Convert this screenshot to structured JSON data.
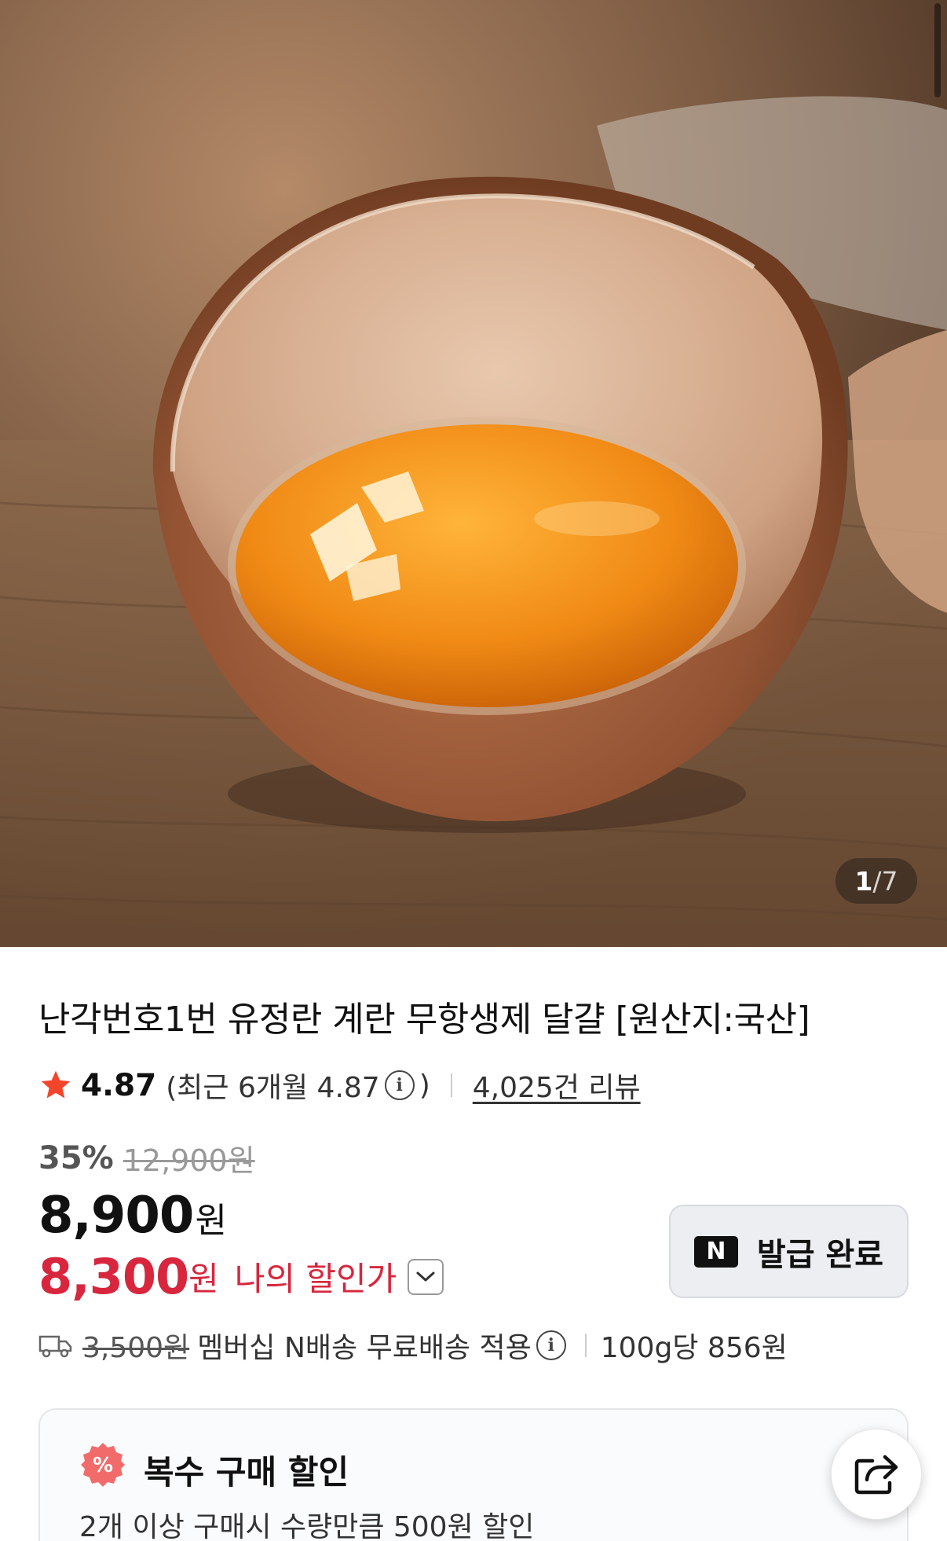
{
  "image": {
    "current": "1",
    "separator": "/",
    "total": "7"
  },
  "product": {
    "title": "난각번호1번 유정란 계란 무항생제 달걀 [원산지:국산]",
    "rating": "4.87",
    "recent_rating": "(최근 6개월 4.87",
    "recent_close": ")",
    "review_count": "4,025건 리뷰",
    "discount_rate": "35%",
    "original_price": "12,900원",
    "price": "8,900",
    "price_unit": "원",
    "my_price": "8,300",
    "my_price_unit": "원",
    "my_price_label": "나의 할인가"
  },
  "coupon": {
    "badge": "N",
    "label": "발급 완료"
  },
  "shipping": {
    "original_fee": "3,500원",
    "text": "멤버십 N배송 무료배송 적용",
    "unit_price": "100g당 856원"
  },
  "bulk_discount": {
    "badge_symbol": "%",
    "title": "복수 구매 할인",
    "description": "2개 이상 구매시 수량만큼 500원 할인"
  },
  "colors": {
    "accent_red": "#d7263d",
    "star": "#f2452c",
    "bulk_badge": "#f26b6b"
  },
  "icons": {
    "star": "star-icon",
    "info": "info-icon",
    "dropdown": "chevron-down-icon",
    "truck": "truck-icon",
    "share": "share-icon"
  }
}
